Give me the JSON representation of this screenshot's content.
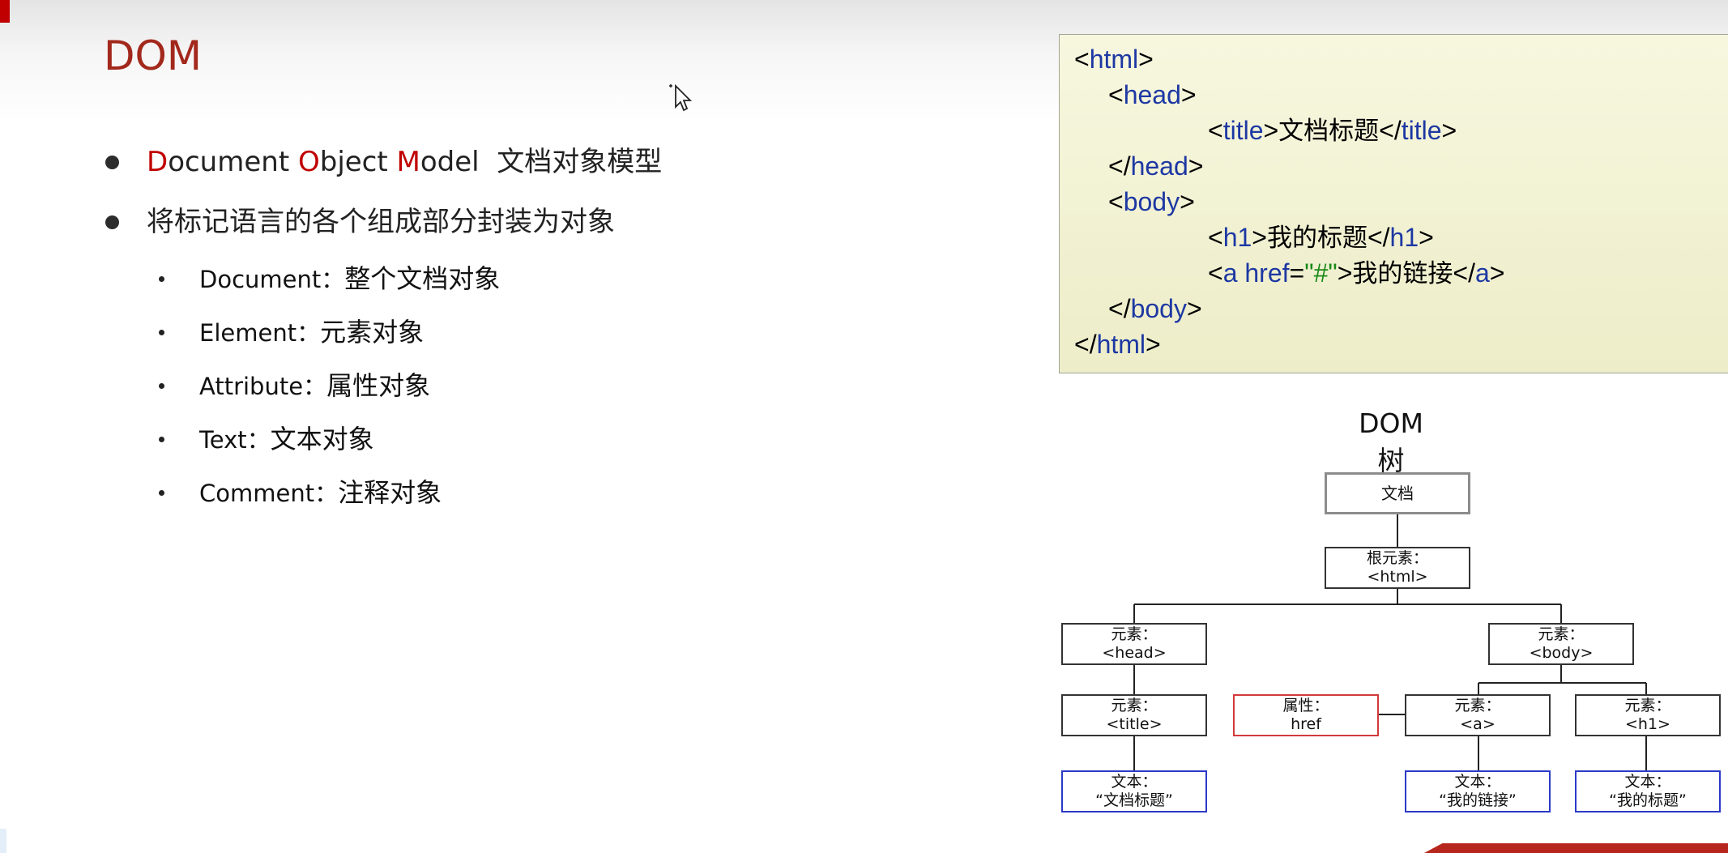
{
  "slide": {
    "title": "DOM",
    "bullets": [
      {
        "D": "D",
        "ocument": "ocument ",
        "O": "O",
        "bject": "bject ",
        "M": "M",
        "odel": "odel  ",
        "cn": "文档对象模型"
      },
      {
        "text": "将标记语言的各个组成部分封装为对象"
      }
    ],
    "sub_items": [
      {
        "label": "Document：",
        "desc": "整个文档对象"
      },
      {
        "label": "Element：",
        "desc": "元素对象"
      },
      {
        "label": "Attribute：",
        "desc": "属性对象"
      },
      {
        "label": "Text：",
        "desc": "文本对象"
      },
      {
        "label": "Comment：",
        "desc": "注释对象"
      }
    ]
  },
  "code": {
    "html": "html",
    "head": "head",
    "title_tag": "title",
    "title_text": "文档标题",
    "body": "body",
    "h1": "h1",
    "h1_text": "我的标题",
    "a": "a",
    "href": "href",
    "href_value": "\"#\"",
    "a_text": "我的链接"
  },
  "tree": {
    "title": "DOM 树",
    "nodes": {
      "document": "文档",
      "root_label": "根元素：",
      "root_value": "<html>",
      "head_label": "元素：",
      "head_value": "<head>",
      "body_label": "元素：",
      "body_value": "<body>",
      "title_label": "元素：",
      "title_value": "<title>",
      "attr_label": "属性：",
      "attr_value": "href",
      "a_label": "元素：",
      "a_value": "<a>",
      "h1_label": "元素：",
      "h1_value": "<h1>",
      "text1_label": "文本：",
      "text1_value": "“文档标题”",
      "text2_label": "文本：",
      "text2_value": "“我的链接”",
      "text3_label": "文本：",
      "text3_value": "“我的标题”"
    }
  },
  "colors": {
    "title_red": "#a3281c",
    "initial_red": "#c00000",
    "code_keyword_blue": "#1d38a3",
    "code_string_green": "#188a18",
    "code_bg": "#f2f2d4",
    "attr_border": "#d23a3a",
    "text_border": "#2b39c6"
  }
}
